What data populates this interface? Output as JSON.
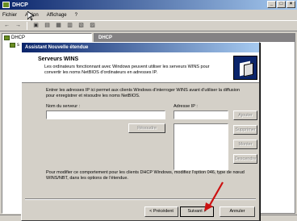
{
  "window": {
    "title": "DHCP",
    "minimize": "_",
    "maximize": "□",
    "close": "×"
  },
  "menu": {
    "items": [
      "Fichier",
      "Action",
      "Affichage",
      "?"
    ]
  },
  "toolbar": {
    "back": "←",
    "forward": "→"
  },
  "tree": {
    "items": [
      "DHCP",
      "s"
    ]
  },
  "right_pane": {
    "header": "DHCP"
  },
  "wizard": {
    "title": "Assistant Nouvelle étendue",
    "heading": "Serveurs WINS",
    "description": "Les ordinateurs fonctionnant avec Windows peuvent utiliser les serveurs WINS pour convertir les noms NetBIOS d'ordinateurs en adresses IP.",
    "intro": "Entrer les adresses IP ici permet aux clients Windows d'interroger WINS avant d'utiliser la diffusion pour enregistrer et résoudre les noms NetBIOS.",
    "server_label": "Nom du serveur :",
    "server_value": "",
    "ip_label": "Adresse IP :",
    "ip_value": "",
    "buttons": {
      "resolve": "Résoudre",
      "add": "Ajouter",
      "remove": "Supprimer",
      "up": "Monter",
      "down": "Descendre",
      "back": "< Précédent",
      "next": "Suivant >",
      "cancel": "Annuler"
    },
    "note": "Pour modifier ce comportement pour les clients DHCP Windows, modifiez l'option 046, type de nœud WINS/NBT, dans les options de l'étendue."
  },
  "colors": {
    "titlebar_start": "#0a246a",
    "titlebar_end": "#a6caf0",
    "annotation_arrow": "#cc1111"
  }
}
